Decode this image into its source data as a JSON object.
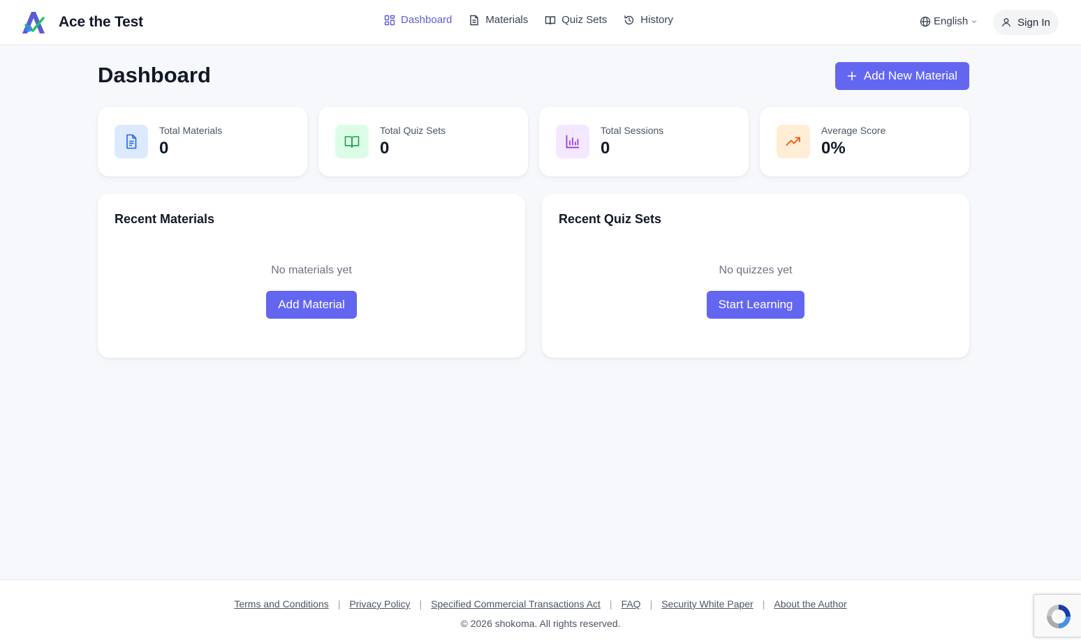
{
  "app": {
    "name": "Ace the Test"
  },
  "nav": [
    {
      "label": "Dashboard",
      "icon": "dashboard-grid-icon",
      "active": true
    },
    {
      "label": "Materials",
      "icon": "document-icon",
      "active": false
    },
    {
      "label": "Quiz Sets",
      "icon": "book-icon",
      "active": false
    },
    {
      "label": "History",
      "icon": "history-icon",
      "active": false
    }
  ],
  "header": {
    "language": "English",
    "sign_in": "Sign In"
  },
  "main": {
    "title": "Dashboard",
    "add_new_label": "Add New Material",
    "stats": [
      {
        "label": "Total Materials",
        "value": "0",
        "icon": "document-icon",
        "color": "#2563eb",
        "bg": "#dbeafe"
      },
      {
        "label": "Total Quiz Sets",
        "value": "0",
        "icon": "book-icon",
        "color": "#16a34a",
        "bg": "#dcfce7"
      },
      {
        "label": "Total Sessions",
        "value": "0",
        "icon": "bar-chart-icon",
        "color": "#9333ea",
        "bg": "#f3e8ff"
      },
      {
        "label": "Average Score",
        "value": "0%",
        "icon": "trending-up-icon",
        "color": "#ea580c",
        "bg": "#ffedd5"
      }
    ],
    "recent_materials": {
      "title": "Recent Materials",
      "empty": "No materials yet",
      "button": "Add Material"
    },
    "recent_quizzes": {
      "title": "Recent Quiz Sets",
      "empty": "No quizzes yet",
      "button": "Start Learning"
    }
  },
  "footer": {
    "links": [
      "Terms and Conditions",
      "Privacy Policy",
      "Specified Commercial Transactions Act",
      "FAQ",
      "Security White Paper",
      "About the Author"
    ],
    "copyright": "© 2026 shokoma. All rights reserved."
  },
  "colors": {
    "accent": "#6366f1",
    "active_nav": "#5b5bd6",
    "background": "#f7f8fb"
  }
}
